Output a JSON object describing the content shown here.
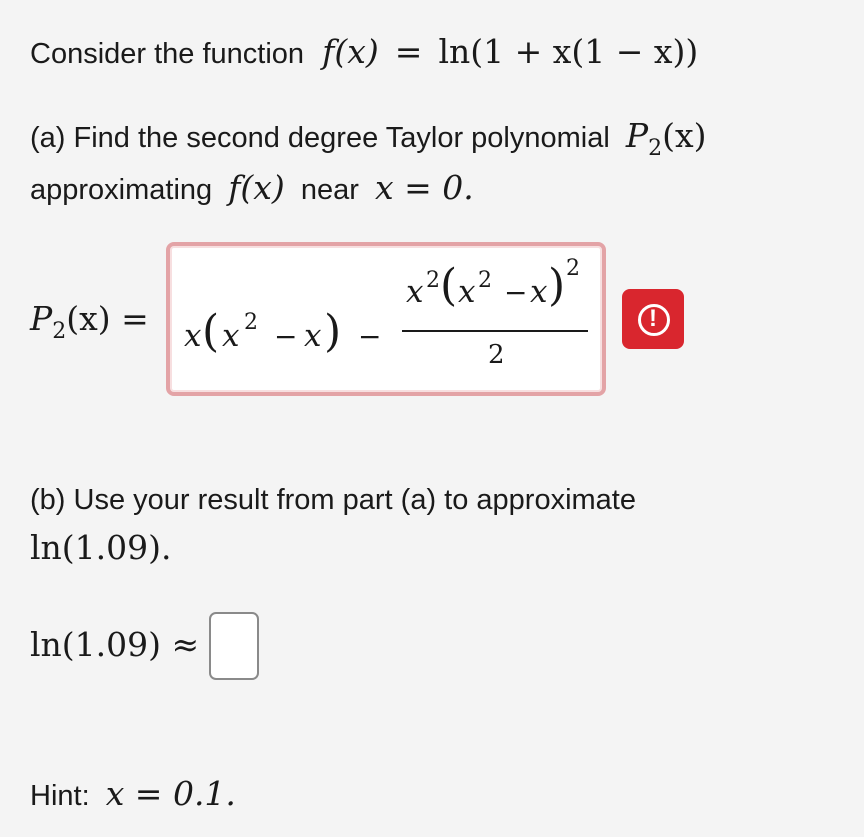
{
  "intro": {
    "text": "Consider the function",
    "function_lhs": "f(x)",
    "equals": "=",
    "function_rhs": "ln(1 + x(1 − x))"
  },
  "part_a": {
    "text_1": "(a) Find the second degree Taylor polynomial",
    "p2": "P",
    "p2_sub": "2",
    "p2_arg": "(x)",
    "text_2": "approximating",
    "fx": "f(x)",
    "text_3": "near",
    "condition": "x = 0.",
    "label_p": "P",
    "label_sub": "2",
    "label_arg": "(x) =",
    "answer": {
      "t1_x": "x",
      "t1_open": "(",
      "t1_x2": "x",
      "t1_exp": "2",
      "t1_minus": "−",
      "t1_x3": "x",
      "t1_close": ")",
      "minus": "−",
      "num_x": "x",
      "num_exp1": "2",
      "num_open": "(",
      "num_x2": "x",
      "num_exp2": "2",
      "num_minus": "−",
      "num_x3": "x",
      "num_close": ")",
      "num_exp3": "2",
      "denominator": "2"
    },
    "status": "warning",
    "status_color": "#d9262e",
    "status_icon": "exclamation-circle-icon",
    "status_symbol": "!"
  },
  "part_b": {
    "text_1": "(b) Use your result from part (a) to approximate",
    "target": "ln(1.09).",
    "prompt": "ln(1.09) ≈",
    "answer_value": ""
  },
  "hint": {
    "label": "Hint:",
    "value": "x = 0.1."
  }
}
